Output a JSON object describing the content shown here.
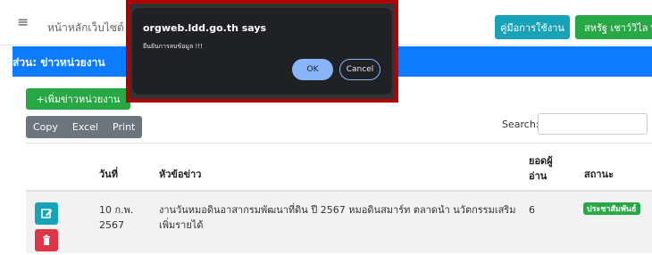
{
  "topbar": {
    "menu_icon": "hamburger-icon",
    "title": "หน้าหลักเว็บไซต์",
    "manual_button": "คู่มือการใช้งาน",
    "user_button": "สหรัฐ เชาว์วิไล"
  },
  "section_title": "ส่วน: ข่าวหน่วยงาน",
  "toolbar": {
    "add_button": "+เพิ่มข่าวหน่วยงาน",
    "export_buttons": [
      "Copy",
      "Excel",
      "Print"
    ],
    "search_label": "Search:",
    "search_value": ""
  },
  "table": {
    "headers": {
      "date": "วันที่",
      "title": "หัวข้อข่าว",
      "views": "ยอดผู้อ่าน",
      "views_line1": "ยอดผู้",
      "views_line2": "อ่าน",
      "status": "สถานะ"
    },
    "rows": [
      {
        "date_line1": "10 ก.พ.",
        "date_line2": "2567",
        "title_line1": "งานวันหมอดินอาสากรมพัฒนาที่ดิน ปี 2567 หมอดินสมาร์ท ตลาดนำ นวัตกรรมเสริม",
        "title_line2": "เพิ่มรายได้",
        "views": "6",
        "status": "ประชาสัมพันธ์",
        "edit_icon": "edit-icon",
        "delete_icon": "trash-icon"
      }
    ]
  },
  "dialog": {
    "title": "orgweb.ldd.go.th says",
    "message": "ยืนยันการลบข้อมูล !!!",
    "ok": "OK",
    "cancel": "Cancel"
  },
  "colors": {
    "header_blue": "#0d7bff",
    "green": "#28a745",
    "teal": "#17a2b8",
    "red": "#dc3545",
    "highlight_border": "#b00000"
  }
}
